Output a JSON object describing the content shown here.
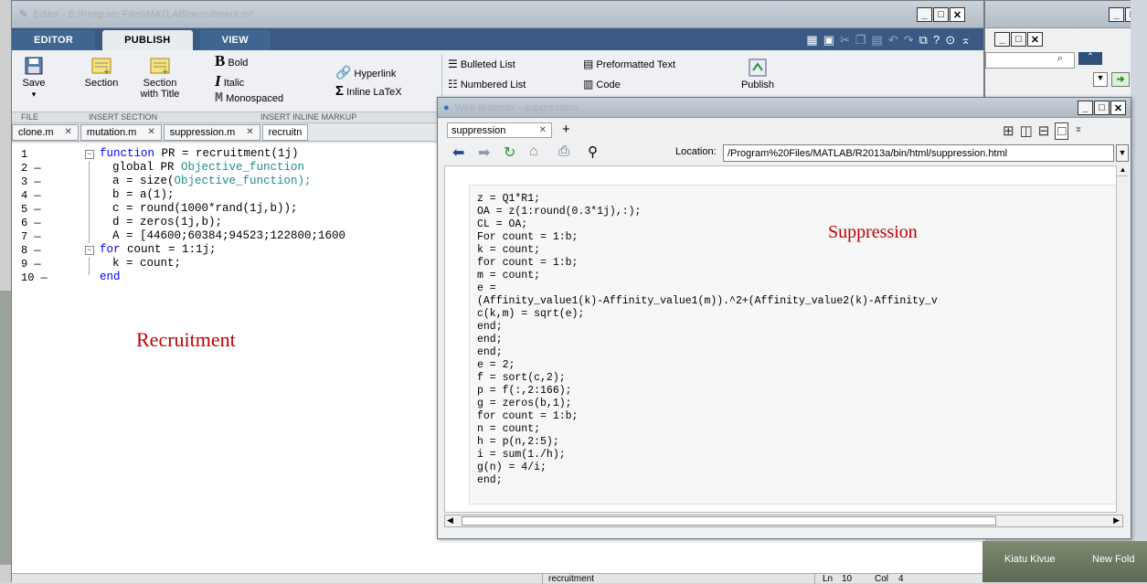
{
  "editor": {
    "title": "Editor - E:\\Program Files\\MATLAB\\recruitment.m*",
    "tabs": [
      "EDITOR",
      "PUBLISH",
      "VIEW"
    ],
    "active_tab": "PUBLISH",
    "ribbon": {
      "save": "Save",
      "section": "Section",
      "section_with_title_1": "Section",
      "section_with_title_2": "with Title",
      "bold": "Bold",
      "italic": "Italic",
      "monospaced": "Monospaced",
      "hyperlink": "Hyperlink",
      "inline_latex": "Inline LaTeX",
      "bulleted_list": "Bulleted List",
      "numbered_list": "Numbered List",
      "preformatted_text": "Preformatted Text",
      "code": "Code",
      "publish": "Publish"
    },
    "group_labels": [
      "FILE",
      "INSERT SECTION",
      "INSERT INLINE MARKUP"
    ],
    "file_tabs": [
      "clone.m",
      "mutation.m",
      "suppression.m",
      "recruitn"
    ],
    "line_numbers": [
      "1",
      "2 —",
      "3 —",
      "4 —",
      "5 —",
      "6 —",
      "7 —",
      "8 —",
      "9 —",
      "10 —"
    ],
    "code_lines": [
      {
        "pre": "function ",
        "kw": "",
        "rest": "PR = recruitment(1j)"
      },
      {
        "pre": "global PR ",
        "kw": "",
        "rest": "Objective_function"
      },
      {
        "pre": "a = size(",
        "kw": "",
        "rest": "Objective_function);"
      },
      {
        "pre": "b = a(1);",
        "kw": "",
        "rest": ""
      },
      {
        "pre": "c = round(1000*rand(1j,b));",
        "kw": "",
        "rest": ""
      },
      {
        "pre": "d = zeros(1j,b);",
        "kw": "",
        "rest": ""
      },
      {
        "pre": "A = [44600;60384;94523;122800;1600",
        "kw": "",
        "rest": ""
      },
      {
        "pre": "for ",
        "kw": "",
        "rest": "count = 1:1j;"
      },
      {
        "pre": "k = count;",
        "kw": "",
        "rest": ""
      },
      {
        "pre": "end",
        "kw": "",
        "rest": ""
      }
    ],
    "annotation": "Recruitment",
    "status_file": "recruitment",
    "status_ln_label": "Ln",
    "status_ln": "10",
    "status_col_label": "Col",
    "status_col": "4"
  },
  "browser": {
    "title": "Web Browser - suppression",
    "tab": "suppression",
    "location_label": "Location:",
    "location": "/Program%20Files/MATLAB/R2013a/bin/html/suppression.html",
    "annotation": "Suppression",
    "code": [
      "z = Q1*R1;",
      "OA = z(1:round(0.3*1j),:);",
      "CL = OA;",
      "For count = 1:b;",
      "k = count;",
      "for count = 1:b;",
      "m = count;",
      "e =",
      "(Affinity_value1(k)-Affinity_value1(m)).^2+(Affinity_value2(k)-Affinity_v",
      "c(k,m) = sqrt(e);",
      "end;",
      "end;",
      "end;",
      "e = 2;",
      "f = sort(c,2);",
      "p = f(:,2:166);",
      "g = zeros(b,1);",
      "for count = 1:b;",
      "n = count;",
      "h = p(n,2:5);",
      "i = sum(1./h);",
      "g(n) = 4/i;",
      "end;"
    ]
  },
  "taskbar": {
    "item1": "Kiatu Kivue",
    "item2": "New Fold"
  }
}
